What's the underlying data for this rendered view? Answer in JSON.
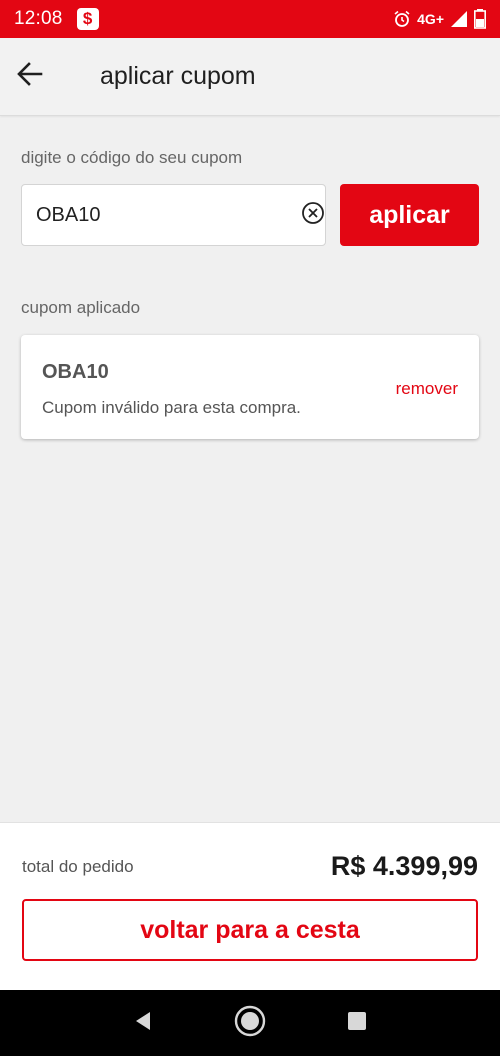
{
  "status_bar": {
    "time": "12:08",
    "app_icon_glyph": "$",
    "network": "4G+",
    "color": "#e30613"
  },
  "app_bar": {
    "back_icon": "arrow-left-icon",
    "title": "aplicar cupom"
  },
  "coupon_form": {
    "label": "digite o código do seu cupom",
    "input_value": "OBA10",
    "clear_icon": "clear-circle-icon",
    "apply_label": "aplicar"
  },
  "applied_coupon": {
    "section_label": "cupom aplicado",
    "code": "OBA10",
    "message": "Cupom inválido para esta compra.",
    "remove_label": "remover"
  },
  "footer": {
    "total_label": "total do pedido",
    "total_value": "R$ 4.399,99",
    "back_to_cart_label": "voltar para a cesta"
  },
  "nav_bar": {
    "buttons": [
      "back-triangle-icon",
      "home-circle-icon",
      "recents-square-icon"
    ]
  },
  "colors": {
    "accent": "#e30613",
    "background": "#f0f0f0"
  }
}
